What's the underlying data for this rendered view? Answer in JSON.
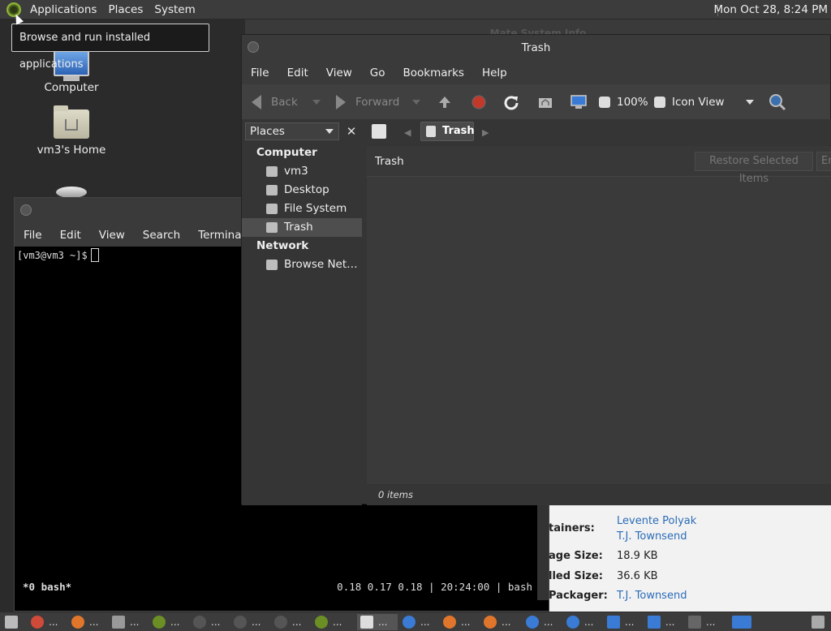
{
  "top_panel": {
    "menus": [
      "Applications",
      "Places",
      "System"
    ],
    "clock": "Mon Oct 28,  8:24 PM"
  },
  "tooltip": "Browse and run installed applications",
  "desktop": {
    "icons": [
      {
        "label": "Computer"
      },
      {
        "label": "vm3's Home"
      }
    ]
  },
  "sysinfo": {
    "title": "Mate System Info",
    "rows": [
      {
        "label": "tainers:",
        "values": [
          "Levente Polyak",
          "T.J. Townsend"
        ]
      },
      {
        "label": "age Size:",
        "value": "18.9 KB"
      },
      {
        "label": "lled Size:",
        "value": "36.6 KB"
      },
      {
        "label": "Packager:",
        "value": "T.J. Townsend"
      }
    ]
  },
  "terminal": {
    "menus": [
      "File",
      "Edit",
      "View",
      "Search",
      "Terminal"
    ],
    "prompt": "[vm3@vm3 ~]$",
    "status_left": "*0 bash*",
    "status_right": "0.18 0.17 0.18 | 20:24:00 | bash"
  },
  "file_manager": {
    "title": "Trash",
    "menus": [
      "File",
      "Edit",
      "View",
      "Go",
      "Bookmarks",
      "Help"
    ],
    "toolbar": {
      "back": "Back",
      "forward": "Forward",
      "zoom": "100%",
      "view_mode": "Icon View"
    },
    "sidebar": {
      "selector": "Places",
      "close": "✕",
      "groups": [
        {
          "title": "Computer",
          "items": [
            "vm3",
            "Desktop",
            "File System",
            "Trash"
          ]
        },
        {
          "title": "Network",
          "items": [
            "Browse Net…"
          ]
        }
      ],
      "selected": "Trash"
    },
    "path": "Trash",
    "content_title": "Trash",
    "restore_label": "Restore Selected Items",
    "empty_label": "Em",
    "status": "0 items"
  },
  "taskbar": {
    "items": [
      "...",
      "...",
      "...",
      "...",
      "...",
      "...",
      "...",
      "...",
      "...",
      "...",
      "...",
      "...",
      "...",
      "...",
      "...",
      "...",
      "..."
    ],
    "active_index": 7
  },
  "colors": {
    "accent": "#8fb33a",
    "link": "#2b6cb8",
    "panel": "#3c3c3c"
  }
}
